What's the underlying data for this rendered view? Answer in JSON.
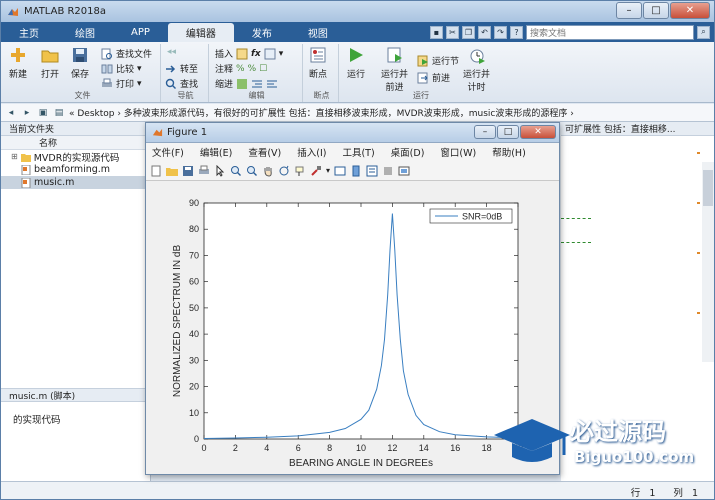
{
  "app": {
    "title": "MATLAB R2018a"
  },
  "tabs": [
    "主页",
    "绘图",
    "APP",
    "编辑器",
    "发布",
    "视图"
  ],
  "search": {
    "placeholder": "搜索文档"
  },
  "ribbon": {
    "file_group": {
      "label": "文件",
      "new": "新建",
      "open": "打开",
      "save": "保存",
      "find_file": "查找文件",
      "compare": "比较",
      "print": "打印"
    },
    "nav_group": {
      "label": "导航",
      "goto": "转至",
      "find": "查找"
    },
    "edit_group": {
      "label": "编辑",
      "insert": "插入",
      "comment": "注释",
      "indent": "缩进"
    },
    "breakpoint_group": {
      "label": "断点",
      "breakpoint": "断点"
    },
    "run_group": {
      "label": "运行",
      "run": "运行",
      "run_advance": "运行并\n前进",
      "run_section": "运行节",
      "advance": "前进",
      "run_time": "运行并\n计时"
    }
  },
  "address": {
    "path": "« Desktop  ›  多种波束形成源代码，有很好的可扩展性 包括：直接相移波束形成，MVDR波束形成，music波束形成的源程序  ›"
  },
  "left_panel": {
    "title": "当前文件夹",
    "column": "名称",
    "items": [
      {
        "name": "MVDR的实现源代码",
        "type": "folder"
      },
      {
        "name": "beamforming.m",
        "type": "file"
      },
      {
        "name": "music.m",
        "type": "file",
        "selected": true
      }
    ],
    "detail_title": "music.m  (脚本)",
    "detail_text": "的实现代码"
  },
  "right_snippet": "可扩展性 包括：直接相移...",
  "status": {
    "row_label": "行",
    "row_value": "1",
    "col_label": "列",
    "col_value": "1"
  },
  "figure": {
    "title": "Figure 1",
    "menu": [
      "文件(F)",
      "编辑(E)",
      "查看(V)",
      "插入(I)",
      "工具(T)",
      "桌面(D)",
      "窗口(W)",
      "帮助(H)"
    ]
  },
  "chart_data": {
    "type": "line",
    "xlabel": "BEARING ANGLE IN DEGREEs",
    "ylabel": "NORMALIZED SPECTRUM IN dB",
    "xlim": [
      0,
      20
    ],
    "ylim": [
      0,
      90
    ],
    "xticks": [
      0,
      2,
      4,
      6,
      8,
      10,
      12,
      14,
      16,
      18,
      20
    ],
    "yticks": [
      0,
      10,
      20,
      30,
      40,
      50,
      60,
      70,
      80,
      90
    ],
    "legend_position": "top-right",
    "series": [
      {
        "name": "SNR=0dB",
        "color": "#3a7fc1",
        "x": [
          0,
          2,
          4,
          6,
          8,
          9,
          10,
          10.5,
          11,
          11.3,
          11.5,
          11.7,
          11.85,
          12,
          12.15,
          12.3,
          12.5,
          12.7,
          13,
          13.5,
          14,
          15,
          16,
          18,
          20
        ],
        "y": [
          0.2,
          0.4,
          0.7,
          1.2,
          2.5,
          4.0,
          7.5,
          11,
          19,
          28,
          38,
          55,
          72,
          86,
          72,
          55,
          38,
          26,
          17,
          9,
          5.5,
          2.8,
          1.6,
          0.8,
          0.4
        ]
      }
    ]
  },
  "watermark": {
    "text": "必过源码",
    "sub": "Biguo100.com"
  }
}
